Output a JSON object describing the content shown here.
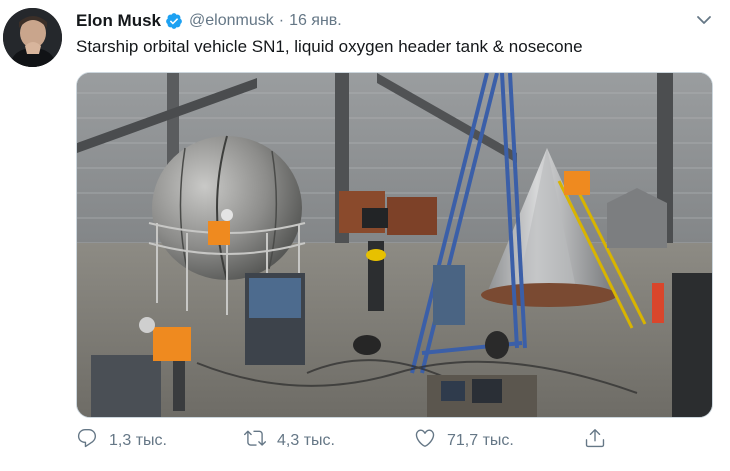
{
  "tweet": {
    "author_name": "Elon Musk",
    "handle": "@elonmusk",
    "separator": "·",
    "date": "16 янв.",
    "text": "Starship orbital vehicle SN1, liquid oxygen header tank & nosecone"
  },
  "actions": {
    "replies": "1,3 тыс.",
    "retweets": "4,3 тыс.",
    "likes": "71,7 тыс."
  },
  "colors": {
    "verified": "#1da1f2",
    "secondary_text": "#657786",
    "primary_text": "#14171a"
  },
  "icons": [
    "verified-badge-icon",
    "chevron-down-icon",
    "reply-icon",
    "retweet-icon",
    "like-icon",
    "share-icon"
  ]
}
